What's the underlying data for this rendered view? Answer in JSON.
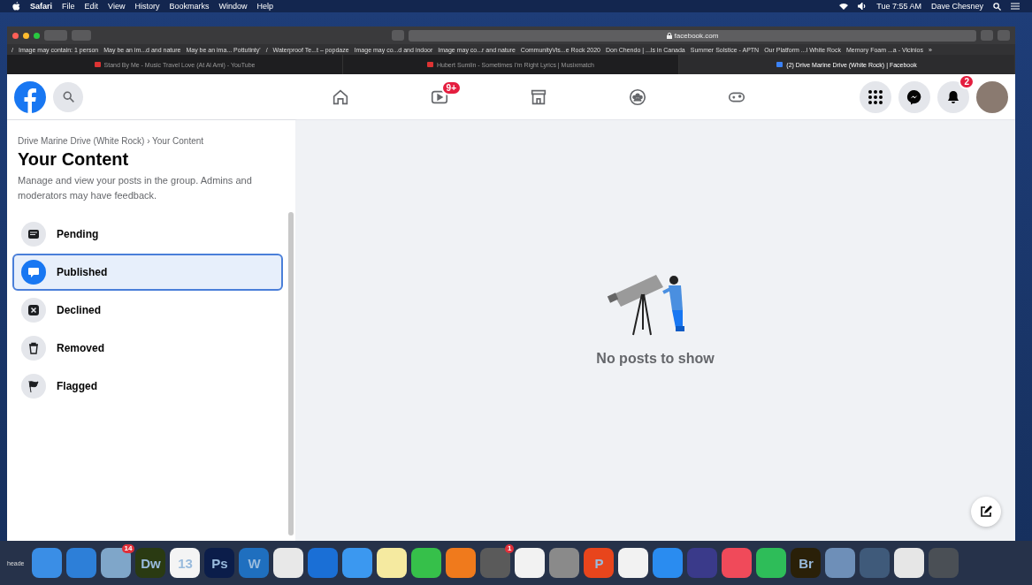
{
  "menu_bar": {
    "app": "Safari",
    "items": [
      "File",
      "Edit",
      "View",
      "History",
      "Bookmarks",
      "Window",
      "Help"
    ],
    "clock": "Tue 7:55 AM",
    "user": "Dave Chesney"
  },
  "toolbar": {
    "url": "facebook.com"
  },
  "bookmarks": [
    "/",
    "Image may contain: 1 person",
    "May be an im...d and nature",
    "May be an ima... Pottutinty'",
    "/",
    "Waterproof Te...t – popdaze",
    "Image may co...d and indoor",
    "Image may co...r and nature",
    "CommunityVis...e Rock 2020",
    "Don Chendo | ...ls in Canada",
    "Summer Solstice - APTN",
    "Our Platform ...l White Rock",
    "Memory Foam ...a - Vicinios",
    "»"
  ],
  "tabs": [
    {
      "title": "Stand By Me - Music Travel Love (At Al Ami) - YouTube",
      "selected": false
    },
    {
      "title": "Hubert Sumlin - Sometimes I'm Right Lyrics | Musixmatch",
      "selected": false
    },
    {
      "title": "(2) Drive Marine Drive (White Rock) | Facebook",
      "selected": true
    }
  ],
  "nav": {
    "tabs": [
      {
        "kind": "home"
      },
      {
        "kind": "watch",
        "badge": "9+"
      },
      {
        "kind": "marketplace"
      },
      {
        "kind": "groups"
      },
      {
        "kind": "gaming"
      }
    ],
    "notifications_badge": "2"
  },
  "sidebar": {
    "breadcrumb": "Drive Marine Drive (White Rock) › Your Content",
    "title": "Your Content",
    "description": "Manage and view your posts in the group. Admins and moderators may have feedback.",
    "items": [
      {
        "kind": "pending",
        "label": "Pending",
        "selected": false
      },
      {
        "kind": "published",
        "label": "Published",
        "selected": true
      },
      {
        "kind": "declined",
        "label": "Declined",
        "selected": false
      },
      {
        "kind": "removed",
        "label": "Removed",
        "selected": false
      },
      {
        "kind": "flagged",
        "label": "Flagged",
        "selected": false
      }
    ]
  },
  "main": {
    "empty_text": "No posts to show"
  },
  "dock": {
    "label": "heade",
    "apps": [
      {
        "color": "#3a8ee6"
      },
      {
        "color": "#2d7fd8"
      },
      {
        "color": "#7fa6c9",
        "badge": "14"
      },
      {
        "color": "#2a3a12",
        "text": "Dw"
      },
      {
        "color": "#f4f4f4",
        "text": "13"
      },
      {
        "color": "#0b1d4a",
        "text": "Ps"
      },
      {
        "color": "#1f6fbf",
        "text": "W"
      },
      {
        "color": "#e8e8e8"
      },
      {
        "color": "#1a6fd6"
      },
      {
        "color": "#3b98f0"
      },
      {
        "color": "#f5eaa0"
      },
      {
        "color": "#36c04a"
      },
      {
        "color": "#f07a1c"
      },
      {
        "color": "#5a5a5a",
        "badge": "1"
      },
      {
        "color": "#f2f2f2"
      },
      {
        "color": "#8a8a8a"
      },
      {
        "color": "#e8451c",
        "text": "P"
      },
      {
        "color": "#f2f2f2"
      },
      {
        "color": "#2a8cf0"
      },
      {
        "color": "#3a3a8a"
      },
      {
        "color": "#f04a5a"
      },
      {
        "color": "#2ebd59"
      },
      {
        "color": "#2a2008",
        "text": "Br"
      },
      {
        "color": "#6e8fb8"
      },
      {
        "color": "#3f5a7a"
      },
      {
        "color": "#e6e6e6"
      },
      {
        "color": "#4a4f55"
      }
    ]
  }
}
